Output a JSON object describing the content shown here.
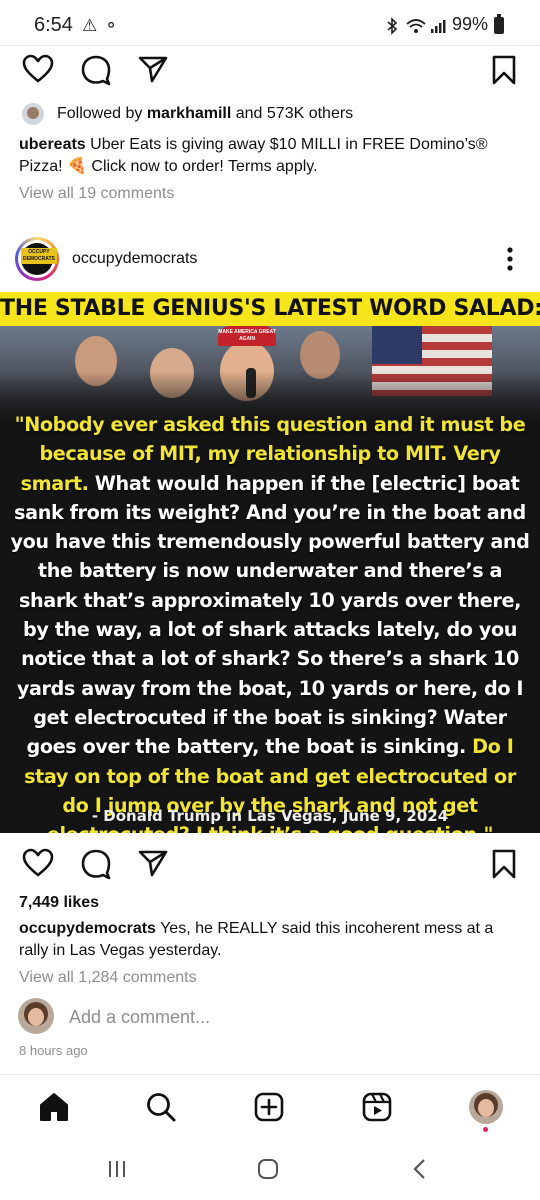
{
  "status_bar": {
    "time": "6:54",
    "battery": "99%"
  },
  "top_post": {
    "followed_by_prefix": "Followed by ",
    "followed_by_user": "markhamill",
    "followed_by_suffix": " and 573K others",
    "caption_user": "ubereats",
    "caption_text": " Uber Eats is giving away $10 MILLI in FREE Domino’s® Pizza! 🍕 Click now to order! Terms apply.",
    "view_comments": "View all 19 comments"
  },
  "post": {
    "username": "occupydemocrats",
    "avatar_logo_text": "OCCUPY DEMOCRATS",
    "image": {
      "headline": "THE STABLE GENIUS'S LATEST WORD SALAD:",
      "hat_text": "MAKE AMERICA GREAT AGAIN",
      "quote_yellow_1": "\"Nobody ever asked this question and it must be because of MIT, my relationship to MIT. Very smart.",
      "quote_white": " What would happen if the [electric] boat sank from its weight? And you’re in the boat and you have this tremendously powerful battery and the battery is now underwater and there’s a shark that’s approximately 10 yards over there, by the way, a lot of shark attacks lately, do you notice that a lot of shark? So there’s a shark 10 yards away from the boat, 10 yards or here, do I get electrocuted if the boat is sinking? Water goes over the battery, the boat is sinking.",
      "quote_yellow_2": " Do I stay on top of the boat and get electrocuted or do I jump over by the shark and not get electrocuted? I think it’s a good question.\"",
      "attribution": "- Donald Trump in Las Vegas, June 9, 2024"
    },
    "likes": "7,449 likes",
    "caption_user": "occupydemocrats",
    "caption_text": " Yes, he REALLY said this incoherent mess at a rally in Las Vegas yesterday.",
    "view_comments": "View all 1,284 comments",
    "add_comment_placeholder": "Add a comment...",
    "time_ago": "8 hours ago"
  },
  "colors": {
    "headline_yellow": "#f5e51a",
    "quote_yellow": "#f1e433",
    "notification_dot": "#e0245e"
  },
  "icons": {
    "like": "heart-icon",
    "comment": "comment-bubble-icon",
    "share": "paper-plane-icon",
    "save": "bookmark-icon",
    "home": "home-icon",
    "search": "search-icon",
    "create": "plus-square-icon",
    "reels": "reels-icon"
  }
}
